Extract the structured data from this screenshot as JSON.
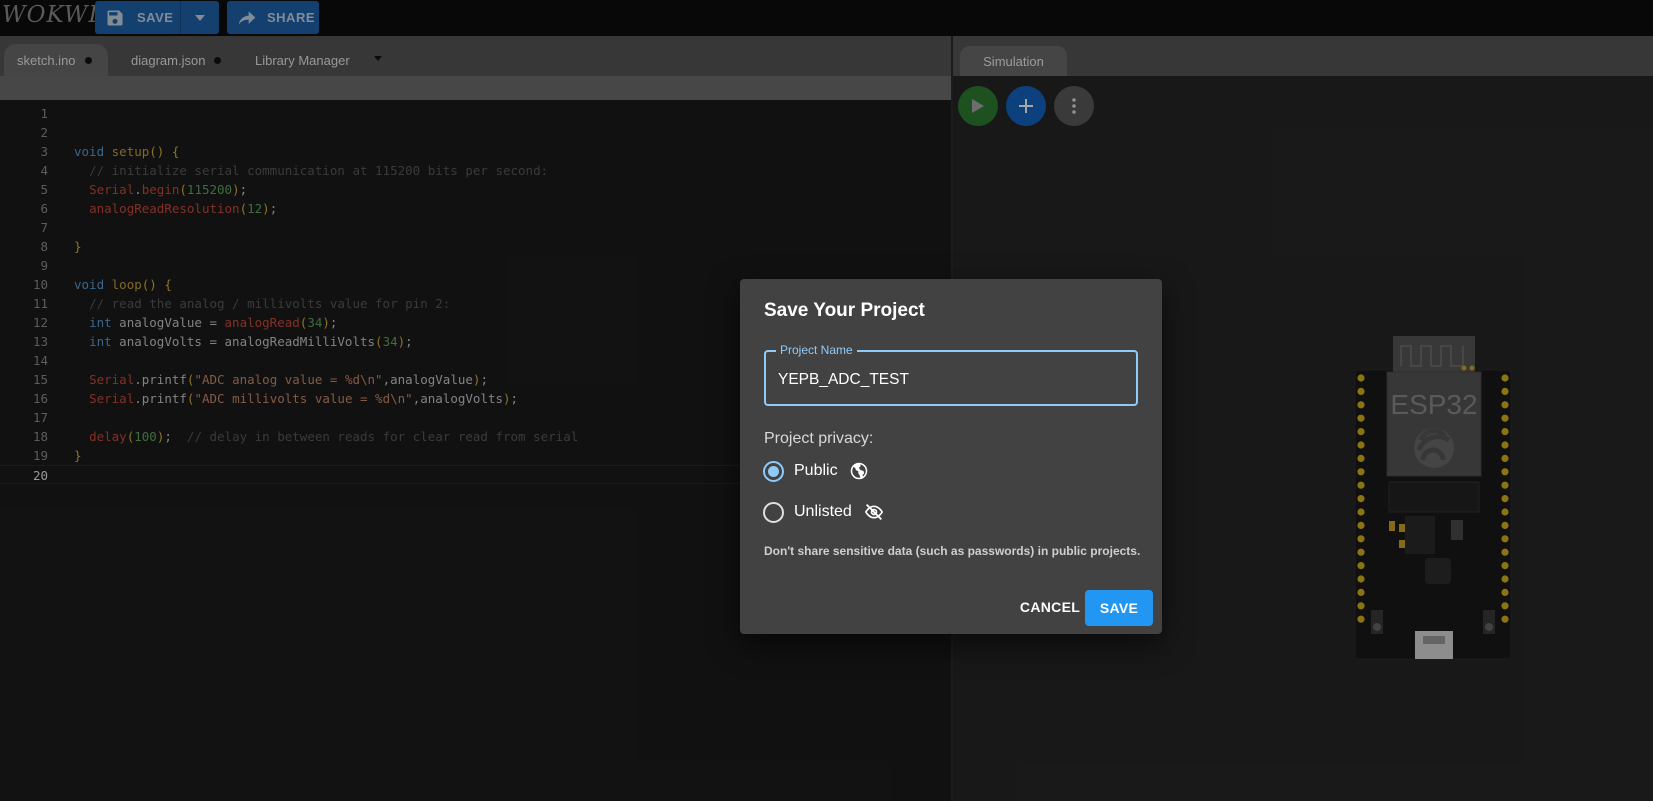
{
  "app": {
    "logo": "WOKWI"
  },
  "toolbar": {
    "save_label": "SAVE",
    "share_label": "SHARE"
  },
  "editor": {
    "tabs": [
      {
        "label": "sketch.ino",
        "modified": true,
        "active": true
      },
      {
        "label": "diagram.json",
        "modified": true,
        "active": false
      },
      {
        "label": "Library Manager",
        "modified": false,
        "active": false
      }
    ],
    "current_line": 20,
    "lines": [
      {
        "n": "1",
        "segments": []
      },
      {
        "n": "2",
        "segments": []
      },
      {
        "n": "3",
        "segments": [
          [
            "kw",
            "void"
          ],
          [
            "plain",
            " "
          ],
          [
            "fn",
            "setup"
          ],
          [
            "br",
            "()"
          ],
          [
            "plain",
            " "
          ],
          [
            "br",
            "{"
          ]
        ]
      },
      {
        "n": "4",
        "segments": [
          [
            "plain",
            "  "
          ],
          [
            "cm",
            "// initialize serial communication at 115200 bits per second:"
          ]
        ]
      },
      {
        "n": "5",
        "segments": [
          [
            "plain",
            "  "
          ],
          [
            "ty",
            "Serial"
          ],
          [
            "plain",
            "."
          ],
          [
            "fnr",
            "begin"
          ],
          [
            "br",
            "("
          ],
          [
            "num",
            "115200"
          ],
          [
            "br",
            ")"
          ],
          [
            "plain",
            ";"
          ]
        ]
      },
      {
        "n": "6",
        "segments": [
          [
            "plain",
            "  "
          ],
          [
            "fnr",
            "analogReadResolution"
          ],
          [
            "br",
            "("
          ],
          [
            "num",
            "12"
          ],
          [
            "br",
            ")"
          ],
          [
            "plain",
            ";"
          ]
        ]
      },
      {
        "n": "7",
        "segments": []
      },
      {
        "n": "8",
        "segments": [
          [
            "br",
            "}"
          ]
        ]
      },
      {
        "n": "9",
        "segments": []
      },
      {
        "n": "10",
        "segments": [
          [
            "kw",
            "void"
          ],
          [
            "plain",
            " "
          ],
          [
            "fn",
            "loop"
          ],
          [
            "br",
            "()"
          ],
          [
            "plain",
            " "
          ],
          [
            "br",
            "{"
          ]
        ]
      },
      {
        "n": "11",
        "segments": [
          [
            "plain",
            "  "
          ],
          [
            "cm",
            "// read the analog / millivolts value for pin 2:"
          ]
        ]
      },
      {
        "n": "12",
        "segments": [
          [
            "plain",
            "  "
          ],
          [
            "kw",
            "int"
          ],
          [
            "plain",
            " analogValue = "
          ],
          [
            "fnr",
            "analogRead"
          ],
          [
            "br",
            "("
          ],
          [
            "num",
            "34"
          ],
          [
            "br",
            ")"
          ],
          [
            "plain",
            ";"
          ]
        ]
      },
      {
        "n": "13",
        "segments": [
          [
            "plain",
            "  "
          ],
          [
            "kw",
            "int"
          ],
          [
            "plain",
            " analogVolts = analogReadMilliVolts"
          ],
          [
            "br",
            "("
          ],
          [
            "num",
            "34"
          ],
          [
            "br",
            ")"
          ],
          [
            "plain",
            ";"
          ]
        ]
      },
      {
        "n": "14",
        "segments": []
      },
      {
        "n": "15",
        "segments": [
          [
            "plain",
            "  "
          ],
          [
            "ty",
            "Serial"
          ],
          [
            "plain",
            ".printf"
          ],
          [
            "br",
            "("
          ],
          [
            "str",
            "\"ADC analog value = %d\\n\""
          ],
          [
            "plain",
            ",analogValue"
          ],
          [
            "br",
            ")"
          ],
          [
            "plain",
            ";"
          ]
        ]
      },
      {
        "n": "16",
        "segments": [
          [
            "plain",
            "  "
          ],
          [
            "ty",
            "Serial"
          ],
          [
            "plain",
            ".printf"
          ],
          [
            "br",
            "("
          ],
          [
            "str",
            "\"ADC millivolts value = %d\\n\""
          ],
          [
            "plain",
            ",analogVolts"
          ],
          [
            "br",
            ")"
          ],
          [
            "plain",
            ";"
          ]
        ]
      },
      {
        "n": "17",
        "segments": []
      },
      {
        "n": "18",
        "segments": [
          [
            "plain",
            "  "
          ],
          [
            "fnr",
            "delay"
          ],
          [
            "br",
            "("
          ],
          [
            "num",
            "100"
          ],
          [
            "br",
            ")"
          ],
          [
            "plain",
            ";  "
          ],
          [
            "cm",
            "// delay in between reads for clear read from serial"
          ]
        ]
      },
      {
        "n": "19",
        "segments": [
          [
            "br",
            "}"
          ]
        ]
      },
      {
        "n": "20",
        "segments": []
      }
    ]
  },
  "simulation": {
    "tab_label": "Simulation",
    "board_label": "ESP32"
  },
  "dialog": {
    "title": "Save Your Project",
    "project_name_label": "Project Name",
    "project_name_value": "YEPB_ADC_TEST",
    "privacy_label": "Project privacy:",
    "options": [
      {
        "label": "Public",
        "checked": true,
        "icon": "globe-icon"
      },
      {
        "label": "Unlisted",
        "checked": false,
        "icon": "eye-off-icon"
      }
    ],
    "warning": "Don't share sensitive data (such as passwords) in public projects.",
    "cancel_label": "CANCEL",
    "save_label": "SAVE"
  },
  "colors": {
    "accent": "#2196f3",
    "focus": "#90caf9",
    "toolbar_button": "#1e63ab",
    "play": "#2e7d32",
    "add": "#1565c0"
  }
}
